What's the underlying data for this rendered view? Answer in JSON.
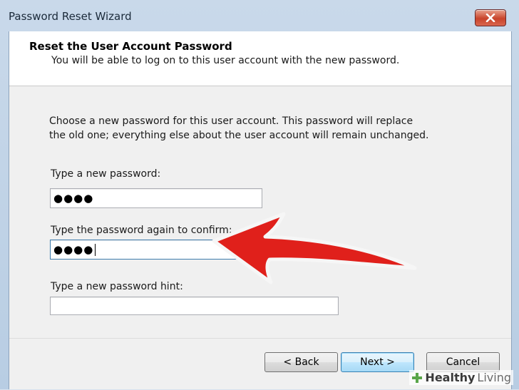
{
  "window": {
    "title": "Password Reset Wizard"
  },
  "header": {
    "title": "Reset the User Account Password",
    "subtitle": "You will be able to log on to this user account with the new password."
  },
  "intro": {
    "line1": "Choose a new password for this user account. This password will replace",
    "line2": "the old one; everything else about the user account will remain unchanged."
  },
  "fields": {
    "new_password": {
      "label": "Type a new password:",
      "value": "●●●●"
    },
    "confirm_password": {
      "label": "Type the password again to confirm:",
      "value": "●●●●"
    },
    "hint": {
      "label": "Type a new password hint:",
      "value": ""
    }
  },
  "buttons": {
    "back": "< Back",
    "next": "Next >",
    "cancel": "Cancel"
  },
  "annotation": {
    "arrow_color": "#e0201b",
    "icon": "red-arrow-icon"
  },
  "watermark": {
    "brand_strong": "Healthy",
    "brand_light": "Living",
    "color": "#5aa64a"
  }
}
